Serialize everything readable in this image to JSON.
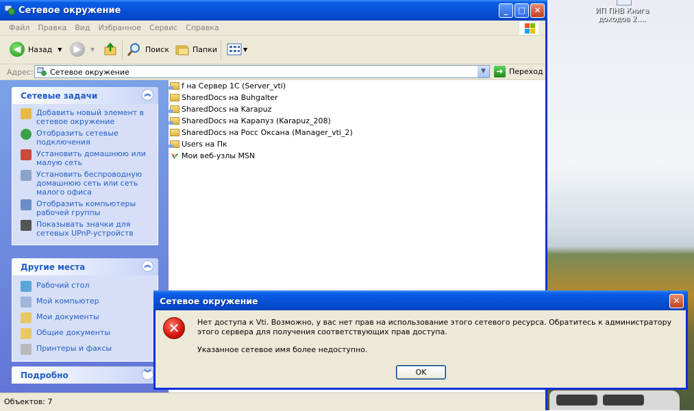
{
  "desktop": {
    "icon_label": "ИП ПНВ Книга доходов 2...."
  },
  "window": {
    "title": "Сетевое окружение",
    "title_icon": "network-places-icon",
    "controls": {
      "minimize": "_",
      "maximize": "□",
      "close": "✕"
    }
  },
  "menu": [
    "Файл",
    "Правка",
    "Вид",
    "Избранное",
    "Сервис",
    "Справка"
  ],
  "toolbar": {
    "back_label": "Назад",
    "search_label": "Поиск",
    "folders_label": "Папки"
  },
  "address": {
    "label": "Адрес:",
    "value": "Сетевое окружение",
    "go_label": "Переход"
  },
  "taskpane": {
    "network_tasks": {
      "title": "Сетевые задачи",
      "items": [
        "Добавить новый элемент в сетевое окружение",
        "Отобразить сетевые подключения",
        "Установить домашнюю или малую сеть",
        "Установить беспроводную домашнюю сеть или сеть малого офиса",
        "Отобразить компьютеры рабочей группы",
        "Показывать значки для сетевых UPnP-устройств"
      ]
    },
    "other_places": {
      "title": "Другие места",
      "items": [
        "Рабочий стол",
        "Мой компьютер",
        "Мои документы",
        "Общие документы",
        "Принтеры и факсы"
      ]
    },
    "details": {
      "title": "Подробно"
    }
  },
  "files": [
    "f на Сервер 1С (Server_vti)",
    "SharedDocs на Buhgalter",
    "SharedDocs на Karapuz",
    "SharedDocs на Карапуз (Karapuz_208)",
    "SharedDocs на Росс Оксана (Manager_vti_2)",
    "Users на Пк",
    "Мои веб-узлы MSN"
  ],
  "status": {
    "text": "Объектов: 7"
  },
  "dialog": {
    "title": "Сетевое окружение",
    "message": "Нет доступа к Vti. Возможно, у вас нет прав на использование этого сетевого ресурса. Обратитесь к администратору этого сервера для получения соответствующих прав доступа.",
    "message2": "Указанное сетевое имя более недоступно.",
    "ok_label": "OK",
    "icon_glyph": "✕"
  },
  "colors": {
    "accent": "#0a5ee8",
    "link": "#215dc6",
    "taskpane": "#7ba2e7"
  }
}
